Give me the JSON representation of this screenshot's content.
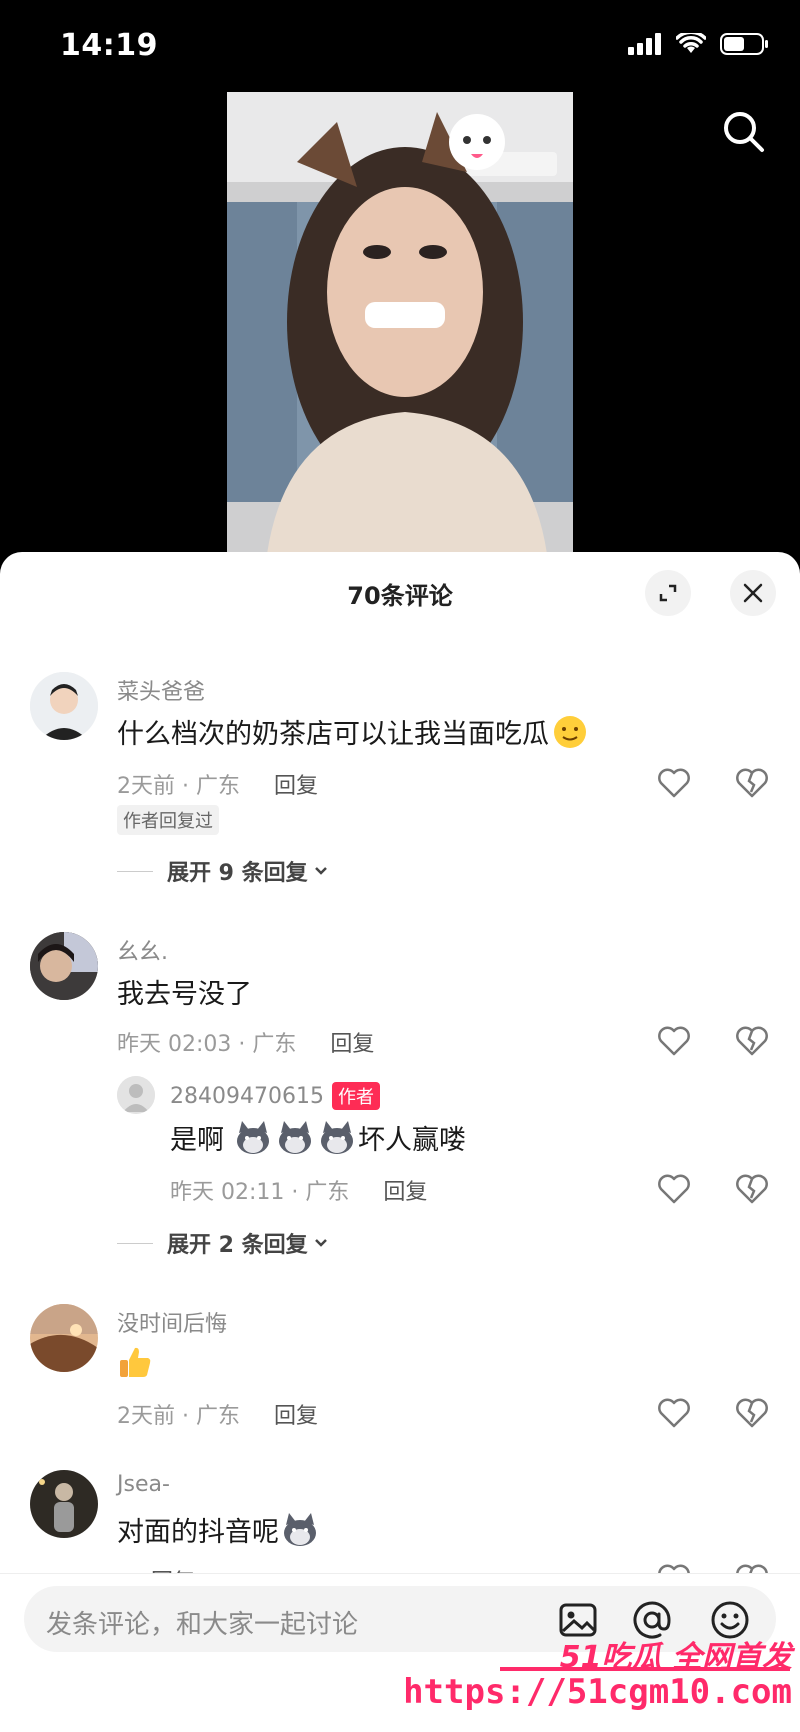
{
  "status": {
    "time": "14:19"
  },
  "sheet": {
    "title": "70条评论"
  },
  "comments": [
    {
      "username": "菜头爸爸",
      "text": "什么档次的奶茶店可以让我当面吃瓜",
      "time_location": "2天前 · 广东",
      "reply_label": "回复",
      "author_replied_badge": "作者回复过",
      "expand_label": "展开 9 条回复"
    },
    {
      "username": "幺幺.",
      "text": "我去号没了",
      "time_location": "昨天 02:03 · 广东",
      "reply_label": "回复",
      "reply": {
        "username": "28409470615",
        "author_badge": "作者",
        "text_prefix": "是啊",
        "text_suffix": "坏人赢喽",
        "time_location": "昨天 02:11 · 广东",
        "reply_label": "回复"
      },
      "expand_label": "展开 2 条回复"
    },
    {
      "username": "没时间后悔",
      "text": "",
      "time_location": "2天前 · 广东",
      "reply_label": "回复"
    },
    {
      "username": "Jsea-",
      "text": "对面的抖音呢",
      "time_location": "",
      "reply_label": "回复"
    }
  ],
  "input": {
    "placeholder": "发条评论，和大家一起讨论"
  },
  "watermark": {
    "line1": "51吃瓜 全网首发",
    "line2": "https://51cgm10.com"
  },
  "colors": {
    "author_badge": "#fe2c55",
    "watermark": "#ff2a6a"
  }
}
